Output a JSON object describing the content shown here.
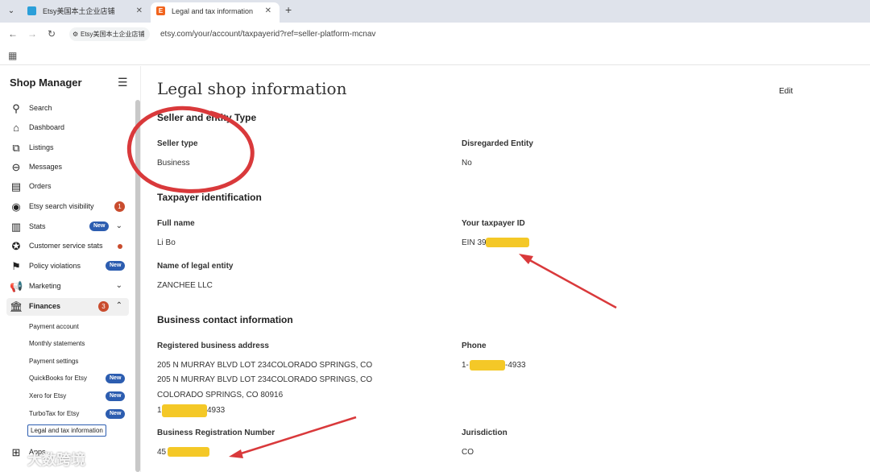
{
  "browser": {
    "tabs": [
      {
        "title": "Etsy美国本土企业店铺"
      },
      {
        "title": "Legal and tax information"
      }
    ],
    "site_chip": "Etsy美国本土企业店铺",
    "url": "etsy.com/your/account/taxpayerid?ref=seller-platform-mcnav"
  },
  "sidebar": {
    "title": "Shop Manager",
    "items": [
      {
        "label": "Search",
        "icon": "search-icon"
      },
      {
        "label": "Dashboard",
        "icon": "home-icon"
      },
      {
        "label": "Listings",
        "icon": "listings-icon"
      },
      {
        "label": "Messages",
        "icon": "messages-icon"
      },
      {
        "label": "Orders",
        "icon": "orders-icon"
      },
      {
        "label": "Etsy search visibility",
        "icon": "visibility-icon",
        "badge": "1"
      },
      {
        "label": "Stats",
        "icon": "stats-icon",
        "badge": "New"
      },
      {
        "label": "Customer service stats",
        "icon": "customer-service-icon"
      },
      {
        "label": "Policy violations",
        "icon": "flag-icon",
        "badge": "New"
      },
      {
        "label": "Marketing",
        "icon": "megaphone-icon"
      },
      {
        "label": "Finances",
        "icon": "bank-icon",
        "badge": "3"
      }
    ],
    "finance_sub": [
      {
        "label": "Payment account"
      },
      {
        "label": "Monthly statements"
      },
      {
        "label": "Payment settings"
      },
      {
        "label": "QuickBooks for Etsy",
        "badge": "New"
      },
      {
        "label": "Xero for Etsy",
        "badge": "New"
      },
      {
        "label": "TurboTax for Etsy",
        "badge": "New"
      },
      {
        "label": "Legal and tax information"
      }
    ],
    "apps_label": "Apps"
  },
  "main": {
    "title": "Legal shop information",
    "edit_label": "Edit",
    "seller_section": {
      "heading": "Seller and entity Type",
      "seller_type_label": "Seller type",
      "seller_type_value": "Business",
      "disregarded_label": "Disregarded Entity",
      "disregarded_value": "No"
    },
    "taxpayer_section": {
      "heading": "Taxpayer identification",
      "full_name_label": "Full name",
      "full_name_value": "Li Bo",
      "taxpayer_id_label": "Your taxpayer ID",
      "taxpayer_id_value": "EIN 39",
      "legal_entity_label": "Name of legal entity",
      "legal_entity_value": "ZANCHEE LLC"
    },
    "contact_section": {
      "heading": "Business contact information",
      "address_label": "Registered business address",
      "address_lines": [
        "205 N MURRAY BLVD LOT 234COLORADO SPRINGS, CO",
        "205 N MURRAY BLVD LOT 234COLORADO SPRINGS, CO",
        "COLORADO SPRINGS, CO 80916",
        "1",
        "4933"
      ],
      "phone_label": "Phone",
      "phone_prefix": "1-",
      "phone_suffix": "-4933",
      "reg_number_label": "Business Registration Number",
      "reg_number_value": "45",
      "jurisdiction_label": "Jurisdiction",
      "jurisdiction_value": "CO"
    }
  },
  "watermark": "大数跨境",
  "colors": {
    "annotation_red": "#d9393b",
    "highlight_yellow": "#f3c20f",
    "badge_blue": "#2c5db0",
    "badge_red": "#c94c2e"
  }
}
